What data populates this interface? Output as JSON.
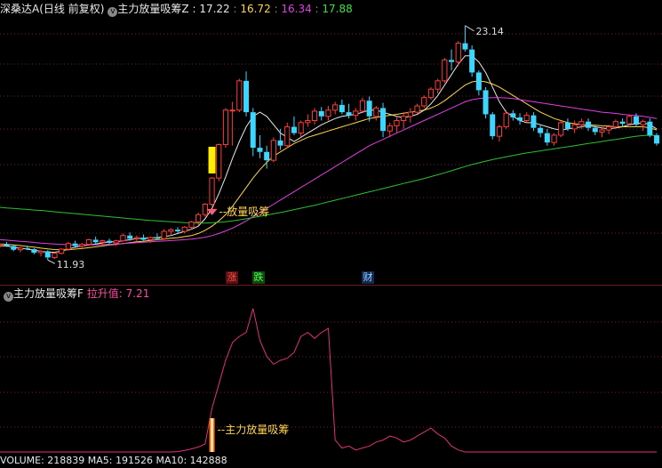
{
  "header": {
    "stock_name": "深桑达A",
    "period": "(日线 前复权)",
    "indicator": "主力放量吸筹Z",
    "values": [
      "17.22",
      "16.72",
      "16.34",
      "17.88"
    ],
    "value_colors": [
      "#e8e8e8",
      "#ffd54a",
      "#e040e0",
      "#40e040"
    ]
  },
  "sub_header": {
    "indicator": "主力放量吸筹F",
    "label": "拉升值",
    "value": "7.21"
  },
  "volume_header": {
    "text": "VOLUME: 218839  MA5: 191526  MA10: 142888"
  },
  "badges": [
    {
      "text": "涨",
      "color": "#ff5050",
      "bg": "#5a1010"
    },
    {
      "text": "跌",
      "color": "#50ff50",
      "bg": "#104a10"
    },
    {
      "text": "财",
      "color": "#9ad0ff",
      "bg": "#102a55"
    }
  ],
  "annotations": {
    "high_label": "23.14",
    "low_label": "11.93",
    "signal_label_main": "放量吸筹",
    "signal_label_sub": "主力放量吸筹"
  },
  "colors": {
    "up": "#ff3c3c",
    "down": "#3cd6ff",
    "ma_white": "#e8e8e8",
    "ma_yellow": "#ffd54a",
    "ma_magenta": "#e040e0",
    "ma_green": "#30c030",
    "sub_line": "#e0307a",
    "grid": "#7a1a1a"
  },
  "chart_data": [
    {
      "type": "candlestick",
      "title": "深桑达A (日线 前复权)",
      "ohlc": [
        [
          12.62,
          12.72,
          12.5,
          12.68
        ],
        [
          12.68,
          12.8,
          12.55,
          12.6
        ],
        [
          12.6,
          12.66,
          12.35,
          12.42
        ],
        [
          12.42,
          12.55,
          12.3,
          12.5
        ],
        [
          12.5,
          12.62,
          12.4,
          12.45
        ],
        [
          12.45,
          12.5,
          12.2,
          12.28
        ],
        [
          12.28,
          12.4,
          12.1,
          12.35
        ],
        [
          12.35,
          12.4,
          11.93,
          12.05
        ],
        [
          12.05,
          12.3,
          11.98,
          12.25
        ],
        [
          12.25,
          12.5,
          12.2,
          12.45
        ],
        [
          12.45,
          12.8,
          12.4,
          12.72
        ],
        [
          12.72,
          12.85,
          12.5,
          12.6
        ],
        [
          12.6,
          12.75,
          12.5,
          12.68
        ],
        [
          12.68,
          12.95,
          12.6,
          12.9
        ],
        [
          12.9,
          13.05,
          12.7,
          12.78
        ],
        [
          12.78,
          12.9,
          12.6,
          12.85
        ],
        [
          12.85,
          12.95,
          12.7,
          12.75
        ],
        [
          12.75,
          12.9,
          12.6,
          12.85
        ],
        [
          12.85,
          13.2,
          12.8,
          13.1
        ],
        [
          13.1,
          13.25,
          12.85,
          12.95
        ],
        [
          12.95,
          13.1,
          12.8,
          13.0
        ],
        [
          13.0,
          13.15,
          12.85,
          12.9
        ],
        [
          12.9,
          13.05,
          12.75,
          13.0
        ],
        [
          13.0,
          13.2,
          12.9,
          12.95
        ],
        [
          12.95,
          13.4,
          12.9,
          13.3
        ],
        [
          13.3,
          13.45,
          13.1,
          13.38
        ],
        [
          13.38,
          13.5,
          13.2,
          13.3
        ],
        [
          13.3,
          13.55,
          13.2,
          13.5
        ],
        [
          13.5,
          13.8,
          13.4,
          13.75
        ],
        [
          13.75,
          14.2,
          13.6,
          14.1
        ],
        [
          14.1,
          14.65,
          14.0,
          14.6
        ],
        [
          14.6,
          15.9,
          14.5,
          15.85
        ],
        [
          15.85,
          17.5,
          15.7,
          17.45
        ],
        [
          17.45,
          19.2,
          17.3,
          19.1
        ],
        [
          19.1,
          19.5,
          17.4,
          19.1
        ],
        [
          19.1,
          20.6,
          19.0,
          20.5
        ],
        [
          20.5,
          20.95,
          18.8,
          19.0
        ],
        [
          19.0,
          19.2,
          16.9,
          17.3
        ],
        [
          17.3,
          17.9,
          16.8,
          17.1
        ],
        [
          17.1,
          17.4,
          16.3,
          16.7
        ],
        [
          16.7,
          17.8,
          16.6,
          17.65
        ],
        [
          17.65,
          18.2,
          17.2,
          17.4
        ],
        [
          17.4,
          18.5,
          17.3,
          18.3
        ],
        [
          18.3,
          18.8,
          17.9,
          18.0
        ],
        [
          18.0,
          18.6,
          17.8,
          18.5
        ],
        [
          18.5,
          18.9,
          18.3,
          18.6
        ],
        [
          18.6,
          19.2,
          18.4,
          19.05
        ],
        [
          19.05,
          19.25,
          18.6,
          18.8
        ],
        [
          18.8,
          19.3,
          18.6,
          19.1
        ],
        [
          19.1,
          19.5,
          18.9,
          19.35
        ],
        [
          19.35,
          19.6,
          18.9,
          19.0
        ],
        [
          19.0,
          19.4,
          18.7,
          18.85
        ],
        [
          18.85,
          19.2,
          18.6,
          19.05
        ],
        [
          19.05,
          19.7,
          18.95,
          19.55
        ],
        [
          19.55,
          19.75,
          18.55,
          18.8
        ],
        [
          18.8,
          19.3,
          18.6,
          19.2
        ],
        [
          19.2,
          19.45,
          17.8,
          18.1
        ],
        [
          18.1,
          18.5,
          17.8,
          18.35
        ],
        [
          18.35,
          18.8,
          18.0,
          18.6
        ],
        [
          18.6,
          19.0,
          18.2,
          18.8
        ],
        [
          18.8,
          19.2,
          18.5,
          19.0
        ],
        [
          19.0,
          19.4,
          18.9,
          19.3
        ],
        [
          19.3,
          19.8,
          19.2,
          19.7
        ],
        [
          19.7,
          20.2,
          19.6,
          20.1
        ],
        [
          20.1,
          20.6,
          19.9,
          20.5
        ],
        [
          20.5,
          21.6,
          20.4,
          21.5
        ],
        [
          21.5,
          22.0,
          21.0,
          21.4
        ],
        [
          21.4,
          22.4,
          21.2,
          22.3
        ],
        [
          22.3,
          23.14,
          21.9,
          22.0
        ],
        [
          22.0,
          22.2,
          20.7,
          20.9
        ],
        [
          20.9,
          21.0,
          19.8,
          20.05
        ],
        [
          20.05,
          20.2,
          18.7,
          18.9
        ],
        [
          18.9,
          19.0,
          17.7,
          17.85
        ],
        [
          17.85,
          18.4,
          17.6,
          18.3
        ],
        [
          18.3,
          19.1,
          18.2,
          18.95
        ],
        [
          18.95,
          19.1,
          18.6,
          18.75
        ],
        [
          18.75,
          18.95,
          18.4,
          18.6
        ],
        [
          18.6,
          19.0,
          18.5,
          18.85
        ],
        [
          18.85,
          19.0,
          18.1,
          18.25
        ],
        [
          18.25,
          18.4,
          17.8,
          18.0
        ],
        [
          18.0,
          18.2,
          17.4,
          17.55
        ],
        [
          17.55,
          18.0,
          17.4,
          17.9
        ],
        [
          17.9,
          18.6,
          17.8,
          18.5
        ],
        [
          18.5,
          18.7,
          18.1,
          18.2
        ],
        [
          18.2,
          18.6,
          18.0,
          18.4
        ],
        [
          18.4,
          18.7,
          18.2,
          18.55
        ],
        [
          18.55,
          18.7,
          18.1,
          18.25
        ],
        [
          18.25,
          18.4,
          17.9,
          18.05
        ],
        [
          18.05,
          18.3,
          17.8,
          18.15
        ],
        [
          18.15,
          18.4,
          17.95,
          18.3
        ],
        [
          18.3,
          18.65,
          18.2,
          18.55
        ],
        [
          18.55,
          18.7,
          18.3,
          18.45
        ],
        [
          18.45,
          18.9,
          18.4,
          18.8
        ],
        [
          18.8,
          18.95,
          18.3,
          18.4
        ],
        [
          18.4,
          18.65,
          18.1,
          18.55
        ],
        [
          18.55,
          18.7,
          17.8,
          17.9
        ],
        [
          17.9,
          18.0,
          17.4,
          17.5
        ]
      ],
      "ma": {
        "white": [
          12.6,
          12.6,
          12.55,
          12.5,
          12.45,
          12.4,
          12.35,
          12.3,
          12.3,
          12.35,
          12.45,
          12.55,
          12.6,
          12.65,
          12.7,
          12.75,
          12.8,
          12.8,
          12.85,
          12.9,
          12.95,
          12.97,
          13.0,
          13.0,
          13.05,
          13.1,
          13.2,
          13.3,
          13.4,
          13.55,
          13.9,
          14.4,
          15.1,
          15.9,
          16.8,
          17.6,
          18.3,
          18.8,
          19.0,
          18.8,
          18.4,
          18.0,
          17.8,
          17.6,
          17.8,
          18.0,
          18.2,
          18.4,
          18.55,
          18.7,
          18.8,
          18.85,
          18.9,
          19.0,
          19.1,
          19.1,
          19.0,
          18.9,
          18.8,
          18.75,
          18.8,
          18.9,
          19.1,
          19.4,
          19.8,
          20.3,
          20.8,
          21.3,
          21.7,
          21.7,
          21.4,
          20.9,
          20.2,
          19.5,
          19.0,
          18.8,
          18.6,
          18.5,
          18.5,
          18.4,
          18.3,
          18.2,
          18.15,
          18.2,
          18.25,
          18.3,
          18.35,
          18.3,
          18.25,
          18.2,
          18.25,
          18.3,
          18.4,
          18.45,
          18.5,
          18.4,
          18.2
        ],
        "yellow": [
          12.7,
          12.68,
          12.65,
          12.62,
          12.58,
          12.55,
          12.5,
          12.46,
          12.43,
          12.42,
          12.42,
          12.45,
          12.48,
          12.52,
          12.56,
          12.6,
          12.65,
          12.68,
          12.72,
          12.76,
          12.8,
          12.83,
          12.87,
          12.9,
          12.93,
          12.97,
          13.0,
          13.05,
          13.1,
          13.2,
          13.35,
          13.55,
          13.8,
          14.1,
          14.5,
          14.95,
          15.4,
          15.85,
          16.25,
          16.6,
          16.9,
          17.1,
          17.3,
          17.5,
          17.65,
          17.8,
          17.9,
          18.0,
          18.1,
          18.2,
          18.3,
          18.4,
          18.5,
          18.6,
          18.7,
          18.75,
          18.8,
          18.85,
          18.9,
          18.95,
          19.0,
          19.05,
          19.1,
          19.2,
          19.35,
          19.55,
          19.8,
          20.05,
          20.3,
          20.45,
          20.5,
          20.45,
          20.35,
          20.2,
          20.0,
          19.8,
          19.6,
          19.4,
          19.2,
          19.0,
          18.85,
          18.7,
          18.6,
          18.5,
          18.45,
          18.4,
          18.4,
          18.38,
          18.35,
          18.33,
          18.3,
          18.3,
          18.3,
          18.3,
          18.3,
          18.25,
          18.15
        ],
        "magenta": [
          12.9,
          12.88,
          12.85,
          12.82,
          12.8,
          12.77,
          12.74,
          12.72,
          12.7,
          12.68,
          12.66,
          12.65,
          12.65,
          12.65,
          12.66,
          12.67,
          12.68,
          12.7,
          12.72,
          12.74,
          12.76,
          12.78,
          12.8,
          12.82,
          12.84,
          12.86,
          12.88,
          12.9,
          12.93,
          12.97,
          13.02,
          13.1,
          13.2,
          13.32,
          13.46,
          13.62,
          13.8,
          14.0,
          14.2,
          14.4,
          14.6,
          14.8,
          15.0,
          15.2,
          15.4,
          15.6,
          15.8,
          16.0,
          16.2,
          16.4,
          16.6,
          16.8,
          17.0,
          17.2,
          17.4,
          17.55,
          17.7,
          17.85,
          18.0,
          18.15,
          18.3,
          18.45,
          18.6,
          18.75,
          18.9,
          19.05,
          19.2,
          19.35,
          19.5,
          19.6,
          19.65,
          19.68,
          19.7,
          19.7,
          19.68,
          19.65,
          19.6,
          19.55,
          19.5,
          19.45,
          19.4,
          19.35,
          19.3,
          19.25,
          19.2,
          19.15,
          19.1,
          19.05,
          19.0,
          18.97,
          18.94,
          18.9,
          18.87,
          18.84,
          18.8,
          18.75,
          18.7
        ],
        "green": [
          14.45,
          14.42,
          14.4,
          14.37,
          14.35,
          14.32,
          14.3,
          14.27,
          14.24,
          14.21,
          14.18,
          14.15,
          14.12,
          14.09,
          14.06,
          14.03,
          14.0,
          13.97,
          13.94,
          13.91,
          13.88,
          13.85,
          13.82,
          13.8,
          13.78,
          13.76,
          13.74,
          13.72,
          13.71,
          13.7,
          13.7,
          13.71,
          13.73,
          13.76,
          13.8,
          13.85,
          13.9,
          13.96,
          14.02,
          14.08,
          14.14,
          14.2,
          14.27,
          14.34,
          14.41,
          14.48,
          14.55,
          14.63,
          14.71,
          14.79,
          14.87,
          14.95,
          15.03,
          15.11,
          15.19,
          15.27,
          15.35,
          15.43,
          15.51,
          15.59,
          15.67,
          15.75,
          15.83,
          15.92,
          16.01,
          16.1,
          16.2,
          16.3,
          16.4,
          16.5,
          16.58,
          16.66,
          16.73,
          16.8,
          16.87,
          16.93,
          16.99,
          17.05,
          17.1,
          17.15,
          17.2,
          17.25,
          17.3,
          17.35,
          17.4,
          17.45,
          17.5,
          17.55,
          17.6,
          17.65,
          17.7,
          17.75,
          17.8,
          17.85,
          17.88,
          17.9,
          17.88
        ]
      },
      "price_range": [
        11.6,
        23.6
      ],
      "signal_index": 31
    },
    {
      "type": "line",
      "title": "主力放量吸筹F",
      "series": [
        {
          "name": "拉升值",
          "values": [
            0,
            0,
            0,
            0,
            0,
            0,
            0,
            0,
            0,
            0,
            0,
            0,
            0,
            0,
            0,
            0,
            0,
            0,
            0,
            0,
            0,
            0,
            0,
            0,
            0,
            0,
            0.2,
            0.8,
            1.5,
            2.5,
            4.0,
            22,
            34,
            46,
            55,
            58,
            60,
            72,
            56,
            48,
            44,
            46,
            47,
            50,
            58,
            60,
            57,
            60,
            62,
            6,
            2,
            3,
            1,
            2,
            3,
            5,
            6,
            8,
            7,
            5,
            6,
            8,
            10,
            12,
            9,
            7,
            3,
            1,
            0,
            0,
            0,
            0,
            0,
            0,
            0,
            0,
            0,
            0,
            0,
            0,
            0,
            0,
            0,
            0,
            0,
            0,
            0,
            0,
            0,
            0,
            0,
            0,
            0,
            0,
            0,
            0,
            0
          ]
        }
      ],
      "ylim": [
        0,
        75
      ],
      "signal_index": 31
    }
  ]
}
